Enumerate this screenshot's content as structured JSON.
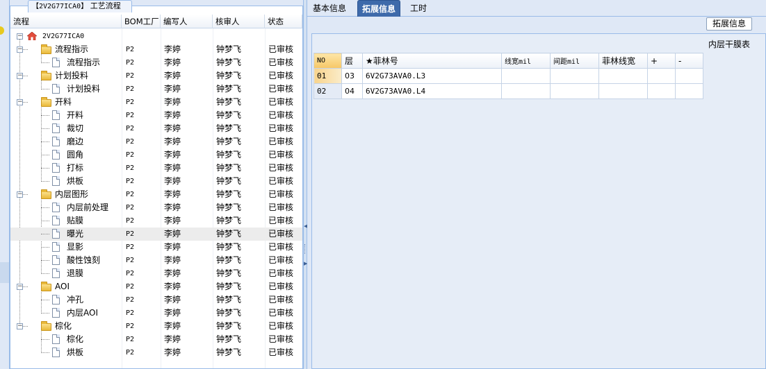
{
  "left_tab": {
    "code": "【2V2G77ICA0】",
    "title": "工艺流程"
  },
  "columns": {
    "flow": "流程",
    "bom": "BOM工厂",
    "writer": "编写人",
    "reviewer": "核审人",
    "status": "状态"
  },
  "root": {
    "label": "2V2G77ICA0"
  },
  "rows": [
    {
      "name": "流程指示",
      "level": 1,
      "type": "folder",
      "bom": "P2",
      "writer": "李婷",
      "reviewer": "钟梦飞",
      "status": "已审核"
    },
    {
      "name": "流程指示",
      "level": 2,
      "type": "doc",
      "bom": "P2",
      "writer": "李婷",
      "reviewer": "钟梦飞",
      "status": "已审核"
    },
    {
      "name": "计划投料",
      "level": 1,
      "type": "folder",
      "bom": "P2",
      "writer": "李婷",
      "reviewer": "钟梦飞",
      "status": "已审核"
    },
    {
      "name": "计划投料",
      "level": 2,
      "type": "doc",
      "bom": "P2",
      "writer": "李婷",
      "reviewer": "钟梦飞",
      "status": "已审核"
    },
    {
      "name": "开料",
      "level": 1,
      "type": "folder",
      "bom": "P2",
      "writer": "李婷",
      "reviewer": "钟梦飞",
      "status": "已审核"
    },
    {
      "name": "开料",
      "level": 2,
      "type": "doc",
      "bom": "P2",
      "writer": "李婷",
      "reviewer": "钟梦飞",
      "status": "已审核"
    },
    {
      "name": "裁切",
      "level": 2,
      "type": "doc",
      "bom": "P2",
      "writer": "李婷",
      "reviewer": "钟梦飞",
      "status": "已审核"
    },
    {
      "name": "磨边",
      "level": 2,
      "type": "doc",
      "bom": "P2",
      "writer": "李婷",
      "reviewer": "钟梦飞",
      "status": "已审核"
    },
    {
      "name": "圆角",
      "level": 2,
      "type": "doc",
      "bom": "P2",
      "writer": "李婷",
      "reviewer": "钟梦飞",
      "status": "已审核"
    },
    {
      "name": "打标",
      "level": 2,
      "type": "doc",
      "bom": "P2",
      "writer": "李婷",
      "reviewer": "钟梦飞",
      "status": "已审核"
    },
    {
      "name": "烘板",
      "level": 2,
      "type": "doc",
      "bom": "P2",
      "writer": "李婷",
      "reviewer": "钟梦飞",
      "status": "已审核"
    },
    {
      "name": "内层图形",
      "level": 1,
      "type": "folder",
      "bom": "P2",
      "writer": "李婷",
      "reviewer": "钟梦飞",
      "status": "已审核"
    },
    {
      "name": "内层前处理",
      "level": 2,
      "type": "doc",
      "bom": "P2",
      "writer": "李婷",
      "reviewer": "钟梦飞",
      "status": "已审核"
    },
    {
      "name": "贴膜",
      "level": 2,
      "type": "doc",
      "bom": "P2",
      "writer": "李婷",
      "reviewer": "钟梦飞",
      "status": "已审核"
    },
    {
      "name": "曝光",
      "level": 2,
      "type": "doc",
      "bom": "P2",
      "writer": "李婷",
      "reviewer": "钟梦飞",
      "status": "已审核",
      "selected": true
    },
    {
      "name": "显影",
      "level": 2,
      "type": "doc",
      "bom": "P2",
      "writer": "李婷",
      "reviewer": "钟梦飞",
      "status": "已审核"
    },
    {
      "name": "酸性蚀刻",
      "level": 2,
      "type": "doc",
      "bom": "P2",
      "writer": "李婷",
      "reviewer": "钟梦飞",
      "status": "已审核"
    },
    {
      "name": "退膜",
      "level": 2,
      "type": "doc",
      "bom": "P2",
      "writer": "李婷",
      "reviewer": "钟梦飞",
      "status": "已审核"
    },
    {
      "name": "AOI",
      "level": 1,
      "type": "folder",
      "bom": "P2",
      "writer": "李婷",
      "reviewer": "钟梦飞",
      "status": "已审核"
    },
    {
      "name": "冲孔",
      "level": 2,
      "type": "doc",
      "bom": "P2",
      "writer": "李婷",
      "reviewer": "钟梦飞",
      "status": "已审核"
    },
    {
      "name": "内层AOI",
      "level": 2,
      "type": "doc",
      "bom": "P2",
      "writer": "李婷",
      "reviewer": "钟梦飞",
      "status": "已审核"
    },
    {
      "name": "棕化",
      "level": 1,
      "type": "folder",
      "bom": "P2",
      "writer": "李婷",
      "reviewer": "钟梦飞",
      "status": "已审核"
    },
    {
      "name": "棕化",
      "level": 2,
      "type": "doc",
      "bom": "P2",
      "writer": "李婷",
      "reviewer": "钟梦飞",
      "status": "已审核"
    },
    {
      "name": "烘板",
      "level": 2,
      "type": "doc",
      "bom": "P2",
      "writer": "李婷",
      "reviewer": "钟梦飞",
      "status": "已审核"
    }
  ],
  "tabs": [
    {
      "label": "基本信息",
      "active": false
    },
    {
      "label": "拓展信息",
      "active": true
    },
    {
      "label": "工时",
      "active": false
    }
  ],
  "expand_button": "拓展信息",
  "sub_panel_title": "内层干膜表",
  "inner_table": {
    "headers": [
      "NO",
      "层",
      "★菲林号",
      "线宽mil",
      "间距mil",
      "菲林线宽",
      "+",
      "-"
    ],
    "rows": [
      [
        "01",
        "03",
        "6V2G73AVA0.L3",
        "",
        "",
        "",
        "",
        ""
      ],
      [
        "02",
        "04",
        "6V2G73AVA0.L4",
        "",
        "",
        "",
        "",
        ""
      ]
    ]
  }
}
